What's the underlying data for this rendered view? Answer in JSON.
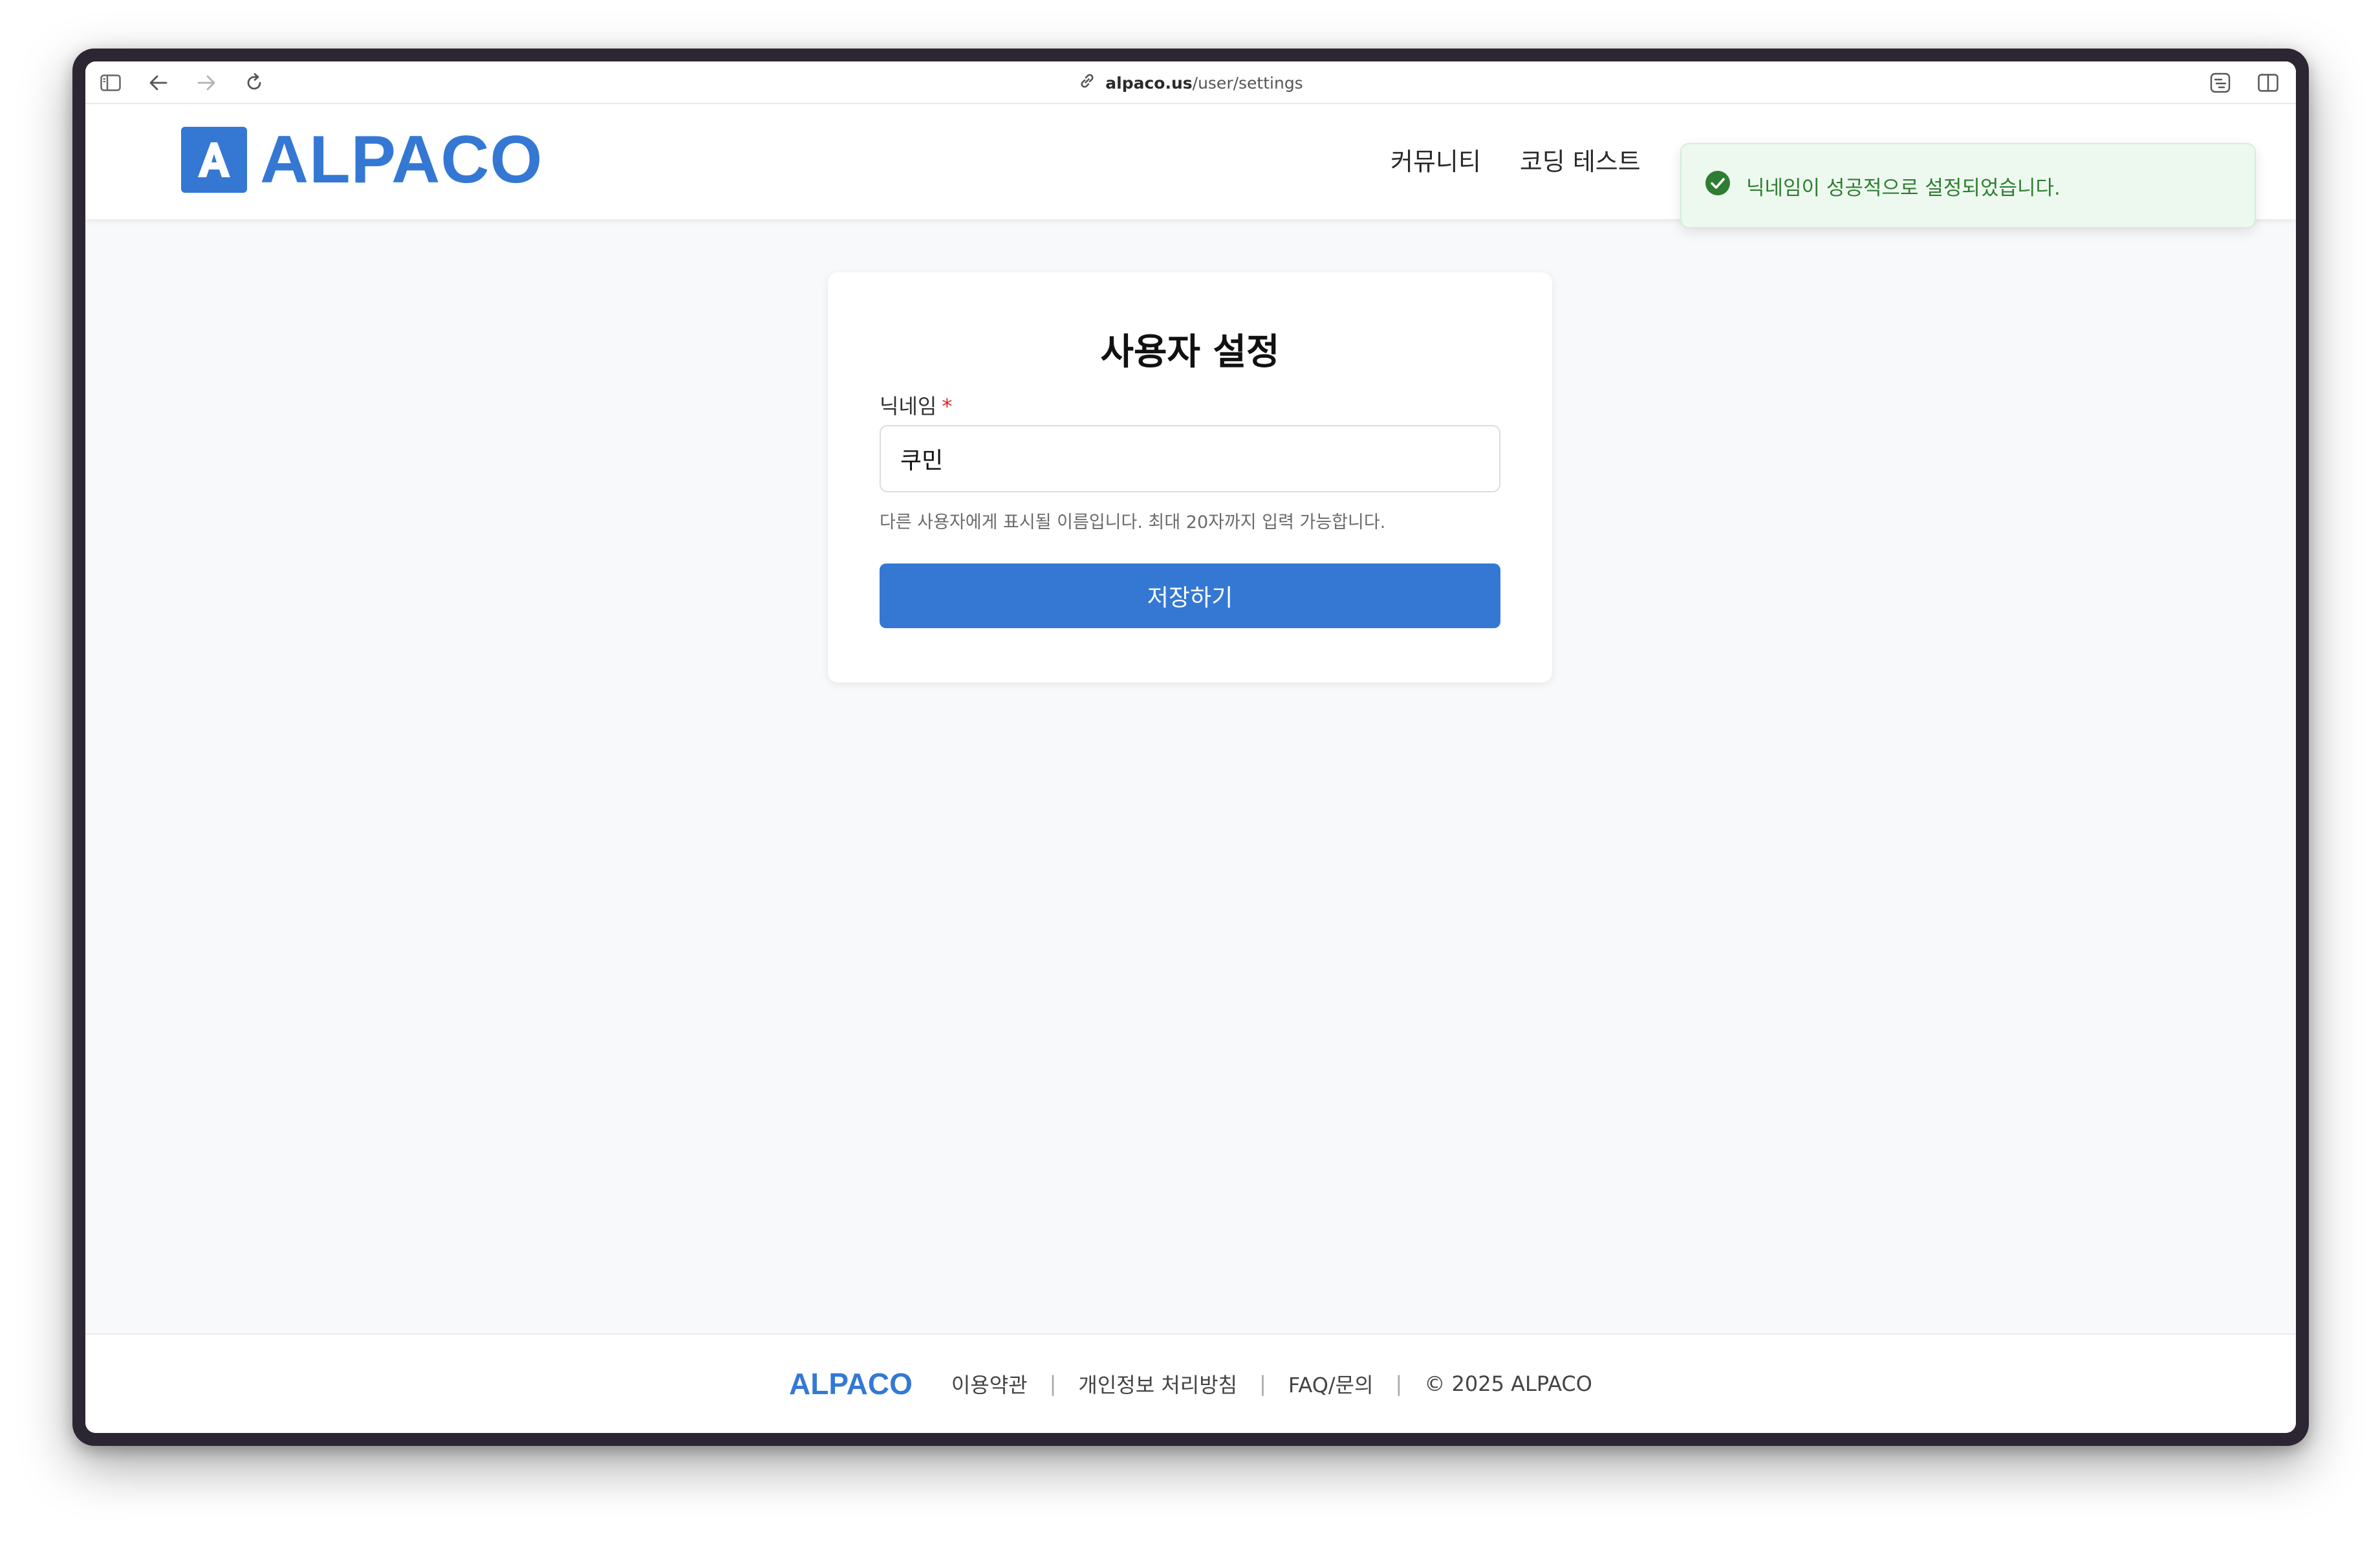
{
  "browser": {
    "url_host": "alpaco.us",
    "url_path": "/user/settings"
  },
  "header": {
    "logo_mark": "A",
    "logo_text": "ALPACO",
    "nav": [
      {
        "label": "커뮤니티"
      },
      {
        "label": "코딩 테스트"
      }
    ]
  },
  "toast": {
    "message": "닉네임이 성공적으로 설정되었습니다."
  },
  "settings": {
    "title": "사용자 설정",
    "nickname_label": "닉네임",
    "required_mark": "*",
    "nickname_value": "쿠민",
    "help_text": "다른 사용자에게 표시될 이름입니다. 최대 20자까지 입력 가능합니다.",
    "save_label": "저장하기"
  },
  "footer": {
    "logo": "ALPACO",
    "links": [
      "이용약관",
      "개인정보 처리방침",
      "FAQ/문의"
    ],
    "separator": "|",
    "copyright": "© 2025 ALPACO"
  },
  "colors": {
    "brand": "#3478d4",
    "toast_bg": "#edf9ef",
    "toast_text": "#2f7d32",
    "required": "#e02424"
  },
  "icons": [
    "sidebar-icon",
    "back-arrow-icon",
    "forward-arrow-icon",
    "reload-icon",
    "link-icon",
    "translate-icon",
    "split-view-icon",
    "check-circle-icon"
  ]
}
